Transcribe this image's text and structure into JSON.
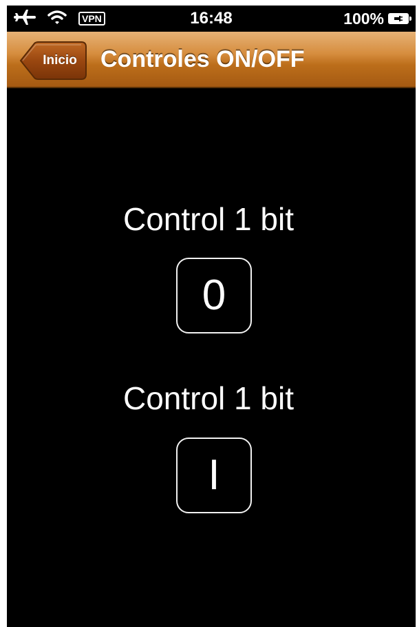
{
  "status_bar": {
    "time": "16:48",
    "vpn": "VPN",
    "battery_percent": "100%",
    "icons": [
      "airplane-icon",
      "wifi-icon",
      "battery-charging-icon"
    ]
  },
  "nav_bar": {
    "back_label": "Inicio",
    "title": "Controles ON/OFF",
    "color": "#b8691a"
  },
  "controls": [
    {
      "label": "Control 1 bit",
      "button_text": "0"
    },
    {
      "label": "Control 1 bit",
      "button_text": "I"
    }
  ],
  "colors": {
    "background": "#000000",
    "text": "#ffffff"
  }
}
